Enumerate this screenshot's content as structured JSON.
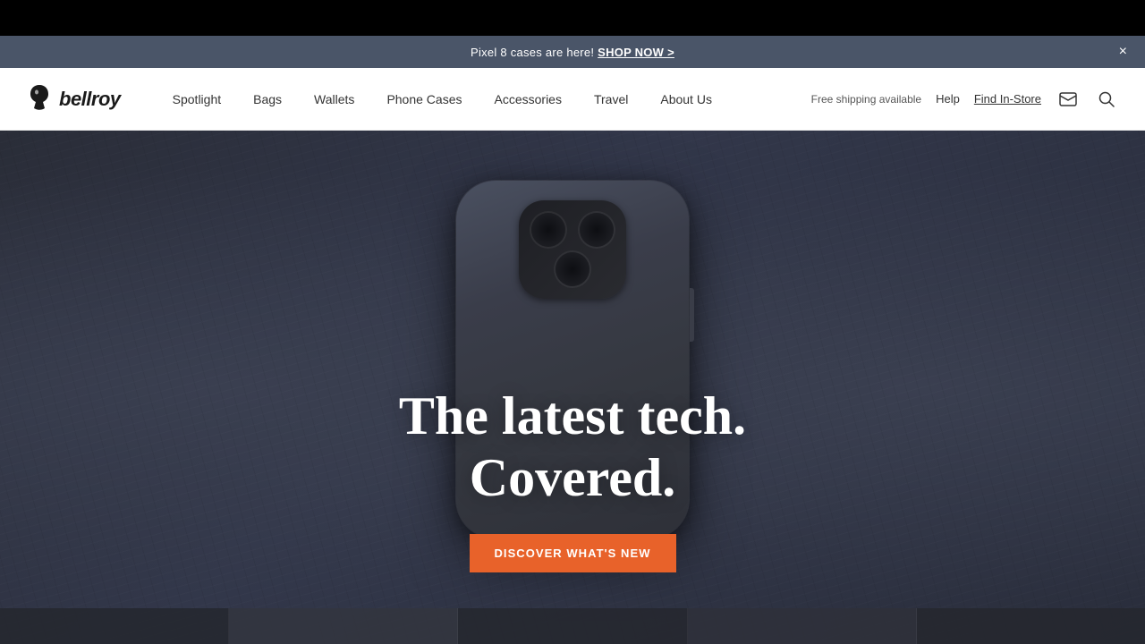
{
  "announcement": {
    "text": "Pixel 8 cases are here!",
    "cta": "SHOP NOW >",
    "close_label": "×"
  },
  "header": {
    "logo_text": "bellroy",
    "shipping_text": "Free shipping available",
    "help_label": "Help",
    "find_store_label": "Find In-Store"
  },
  "nav": {
    "items": [
      {
        "label": "Spotlight",
        "id": "spotlight"
      },
      {
        "label": "Bags",
        "id": "bags"
      },
      {
        "label": "Wallets",
        "id": "wallets"
      },
      {
        "label": "Phone Cases",
        "id": "phone-cases"
      },
      {
        "label": "Accessories",
        "id": "accessories"
      },
      {
        "label": "Travel",
        "id": "travel"
      },
      {
        "label": "About Us",
        "id": "about-us"
      }
    ]
  },
  "hero": {
    "title_line1": "The latest tech.",
    "title_line2": "Covered.",
    "cta_label": "DISCOVER WHAT'S NEW"
  },
  "colors": {
    "accent": "#e8622a",
    "nav_bg": "#ffffff",
    "banner_bg": "#4a5568",
    "hero_bg": "#2d3240"
  }
}
